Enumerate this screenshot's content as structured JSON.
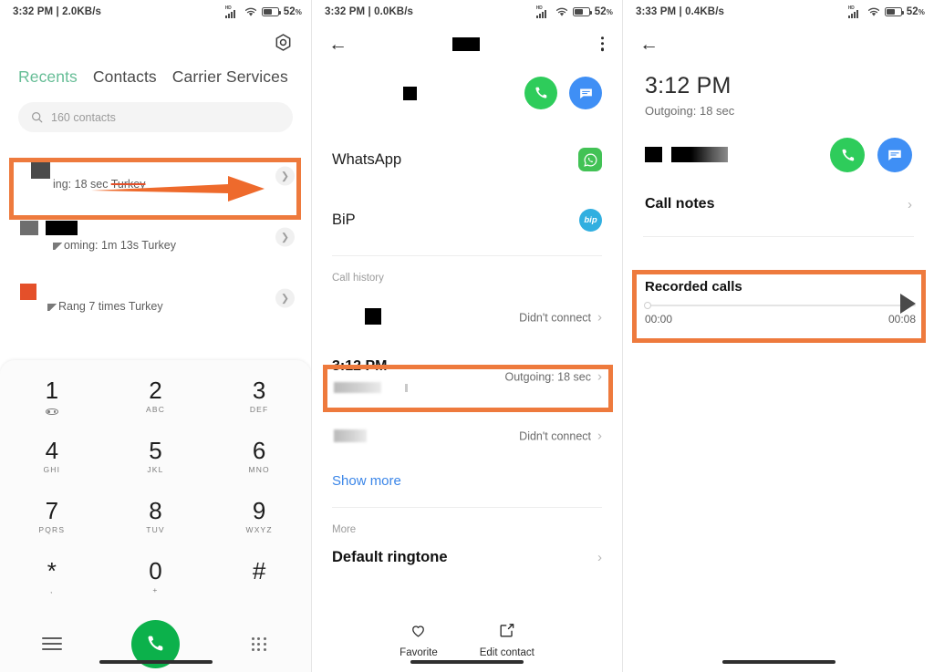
{
  "panels": [
    {
      "id": "recents-dialer",
      "status": {
        "time": "3:32 PM",
        "sep": "|",
        "net_speed": "2.0KB/s",
        "signal": "HD",
        "battery_pct": "52",
        "pct_sign": "%"
      },
      "settings_icon": "gear-icon",
      "tabs": [
        {
          "label": "Recents",
          "active": true
        },
        {
          "label": "Contacts",
          "active": false
        },
        {
          "label": "Carrier Services",
          "active": false
        }
      ],
      "search": {
        "icon": "search-icon",
        "placeholder": "160 contacts"
      },
      "calls": [
        {
          "detail": "ing: 18 sec",
          "strike": "Turkey",
          "highlighted": true
        },
        {
          "detail": "oming: 1m 13s Turkey",
          "highlighted": false
        },
        {
          "detail": "Rang 7 times Turkey",
          "highlighted": false
        }
      ],
      "dialpad": {
        "keys": [
          {
            "digit": "1",
            "letters": "voicemail"
          },
          {
            "digit": "2",
            "letters": "ABC"
          },
          {
            "digit": "3",
            "letters": "DEF"
          },
          {
            "digit": "4",
            "letters": "GHI"
          },
          {
            "digit": "5",
            "letters": "JKL"
          },
          {
            "digit": "6",
            "letters": "MNO"
          },
          {
            "digit": "7",
            "letters": "PQRS"
          },
          {
            "digit": "8",
            "letters": "TUV"
          },
          {
            "digit": "9",
            "letters": "WXYZ"
          },
          {
            "digit": "*",
            "letters": ","
          },
          {
            "digit": "0",
            "letters": "+"
          },
          {
            "digit": "#",
            "letters": ""
          }
        ],
        "call_button": "call-button",
        "left_icon": "menu-icon",
        "right_icon": "keypad-icon"
      }
    },
    {
      "id": "contact-details",
      "status": {
        "time": "3:32 PM",
        "sep": "|",
        "net_speed": "0.0KB/s",
        "signal": "HD",
        "battery_pct": "52",
        "pct_sign": "%"
      },
      "appbar": {
        "back": "back-arrow-icon",
        "title_redacted": true,
        "menu": "overflow-menu-icon"
      },
      "actions": [
        {
          "icon": "phone-icon",
          "color": "#2ecc5b"
        },
        {
          "icon": "message-icon",
          "color": "#3f8ff5"
        }
      ],
      "apps": [
        {
          "label": "WhatsApp",
          "icon": "whatsapp-icon"
        },
        {
          "label": "BiP",
          "icon": "bip-icon",
          "glyph": "bip"
        }
      ],
      "call_history": {
        "header": "Call history",
        "rows": [
          {
            "title": "",
            "status": "Didn't connect",
            "highlighted": false
          },
          {
            "title": "3:12 PM",
            "status": "Outgoing: 18 sec",
            "highlighted": true
          },
          {
            "title": "",
            "status": "Didn't connect",
            "highlighted": false
          }
        ],
        "show_more": "Show more"
      },
      "more": {
        "header": "More",
        "first_item": "Default ringtone"
      },
      "bottom_bar": [
        {
          "label": "Favorite",
          "icon": "heart-icon"
        },
        {
          "label": "Edit contact",
          "icon": "edit-icon"
        }
      ]
    },
    {
      "id": "call-details",
      "status": {
        "time": "3:33 PM",
        "sep": "|",
        "net_speed": "0.4KB/s",
        "signal": "HD",
        "battery_pct": "52",
        "pct_sign": "%"
      },
      "appbar": {
        "back": "back-arrow-icon"
      },
      "time": "3:12 PM",
      "subtitle": "Outgoing: 18 sec",
      "actions": [
        {
          "icon": "phone-icon",
          "color": "#2ecc5b"
        },
        {
          "icon": "message-icon",
          "color": "#3f8ff5"
        }
      ],
      "call_notes": {
        "label": "Call notes",
        "chevron": "chevron-right-icon"
      },
      "recorded_calls": {
        "title": "Recorded calls",
        "elapsed": "00:00",
        "duration": "00:08",
        "play_icon": "play-icon",
        "highlighted": true
      }
    }
  ],
  "theme": {
    "highlight_orange": "#ee7a3d",
    "accent_green": "#66bd96",
    "call_green": "#0cb14b",
    "link_blue": "#3b86e8"
  }
}
